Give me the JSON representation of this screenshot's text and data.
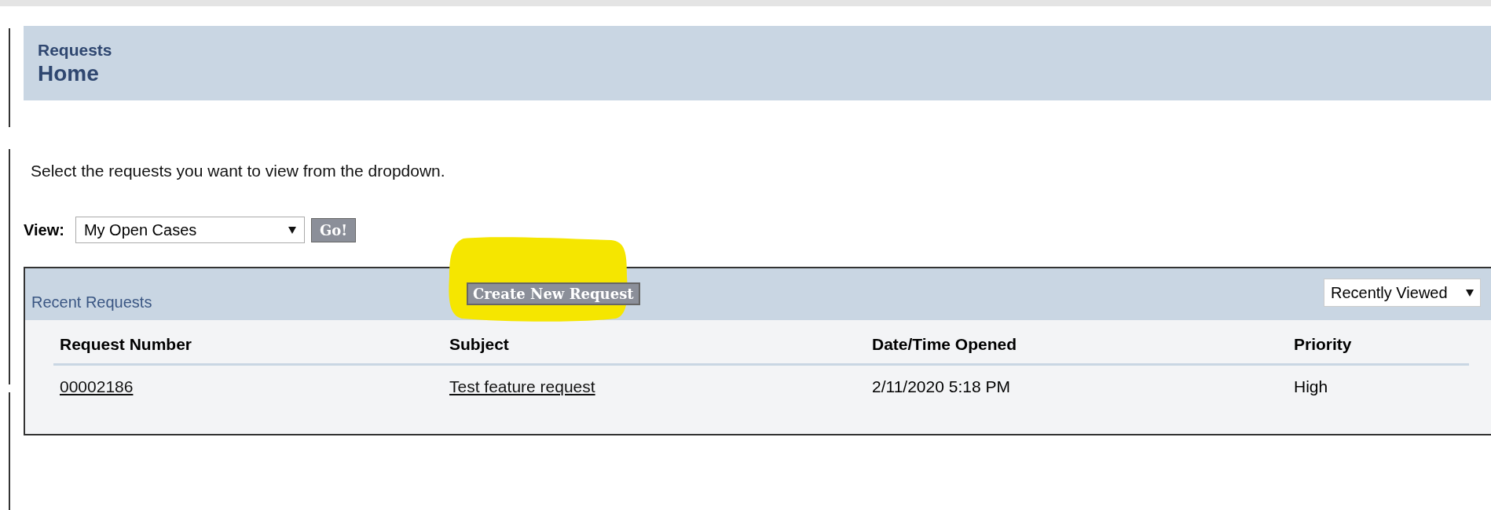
{
  "header": {
    "section": "Requests",
    "title": "Home"
  },
  "instruction": "Select the requests you want to view from the dropdown.",
  "view": {
    "label": "View:",
    "value": "My Open Cases",
    "button": "Go!"
  },
  "panel": {
    "title": "Recent Requests",
    "create_button": "Create New Request",
    "sort": "Recently Viewed",
    "table": {
      "columns": [
        "Request Number",
        "Subject",
        "Date/Time Opened",
        "Priority"
      ],
      "rows": [
        {
          "number": "00002186",
          "subject": "Test feature request",
          "opened": "2/11/2020 5:18 PM",
          "priority": "High"
        }
      ]
    }
  }
}
